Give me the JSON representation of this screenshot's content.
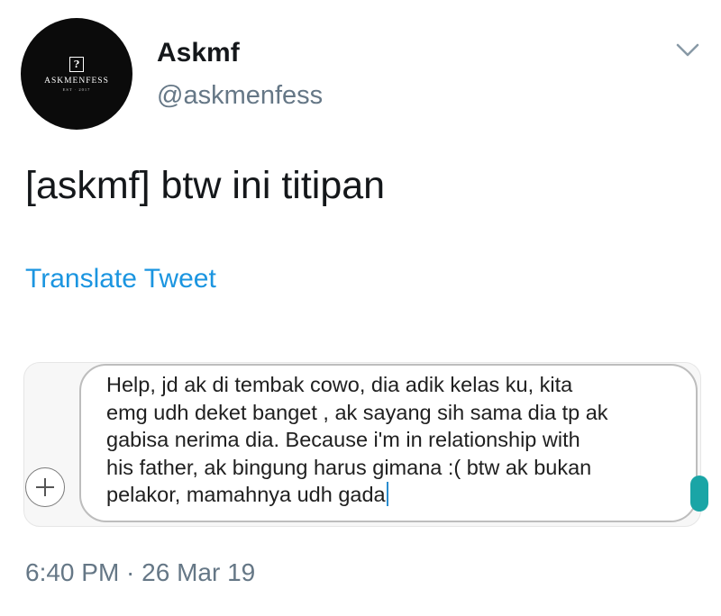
{
  "user": {
    "display_name": "Askmf",
    "handle": "@askmenfess",
    "avatar": {
      "icon": "question-mark-icon",
      "glyph": "?",
      "brand": "ASKMENFESS",
      "tagline": "EST · 2017"
    }
  },
  "tweet": {
    "text": "[askmf] btw ini titipan",
    "translate_label": "Translate Tweet",
    "timestamp": "6:40 PM · 26 Mar 19"
  },
  "attachment": {
    "message_lines": [
      "Help, jd ak di tembak cowo, dia adik kelas ku, kita",
      "emg udh deket banget , ak sayang sih sama dia tp ak",
      "gabisa nerima dia. Because i'm in relationship with",
      "his father, ak bingung harus gimana :( btw ak bukan",
      "pelakor, mamahnya udh gada"
    ],
    "plus_icon": "plus-icon"
  },
  "colors": {
    "link": "#1b95e0",
    "secondary_text": "#657786",
    "caret": "#2a8cce"
  }
}
